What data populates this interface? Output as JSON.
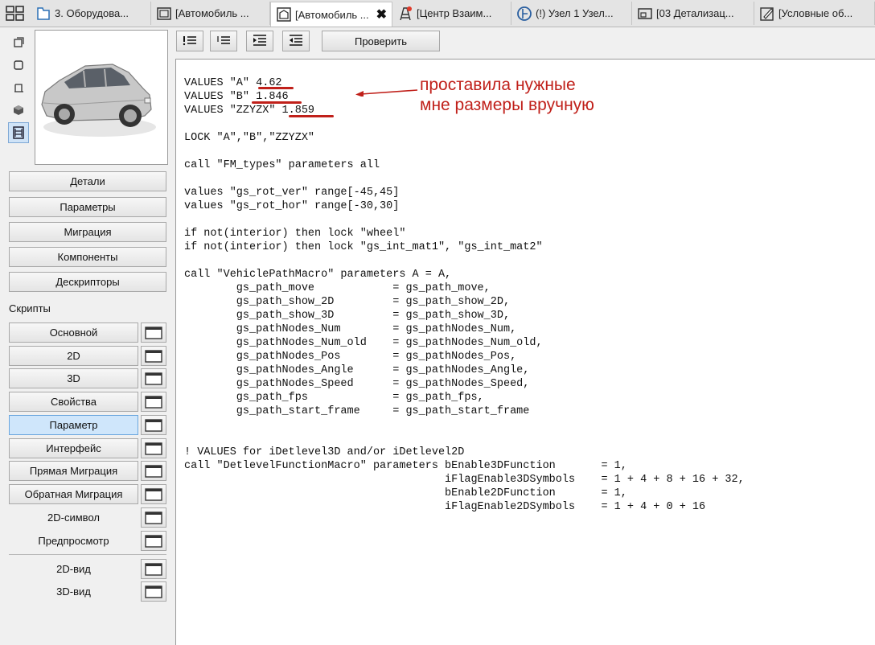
{
  "tabs": [
    {
      "label": "3. Оборудова...",
      "icon": "layout-icon"
    },
    {
      "label": "[Автомобиль ...",
      "icon": "object-icon"
    },
    {
      "label": "[Автомобиль ...",
      "icon": "gdl-object-icon",
      "active": true,
      "close": "✖"
    },
    {
      "label": "[Центр Взаим...",
      "icon": "tower-icon"
    },
    {
      "label": "(!) Узел 1 Узел...",
      "icon": "detail-icon"
    },
    {
      "label": "[03 Детализац...",
      "icon": "window-icon"
    },
    {
      "label": "[Условные об...",
      "icon": "edit-icon"
    }
  ],
  "panel_buttons": [
    "Детали",
    "Параметры",
    "Миграция",
    "Компоненты",
    "Дескрипторы"
  ],
  "scripts_label": "Скрипты",
  "scripts": [
    {
      "label": "Основной"
    },
    {
      "label": "2D"
    },
    {
      "label": "3D"
    },
    {
      "label": "Свойства"
    },
    {
      "label": "Параметр",
      "selected": true
    },
    {
      "label": "Интерфейс"
    },
    {
      "label": "Прямая Миграция"
    },
    {
      "label": "Обратная Миграция"
    },
    {
      "label": "2D-символ",
      "plain": true
    },
    {
      "label": "Предпросмотр",
      "plain": true
    }
  ],
  "views": [
    {
      "label": "2D-вид"
    },
    {
      "label": "3D-вид"
    }
  ],
  "toolbar": {
    "check_label": "Проверить"
  },
  "code": "VALUES \"A\" 4.62\nVALUES \"B\" 1.846\nVALUES \"ZZYZX\" 1.859\n\nLOCK \"A\",\"B\",\"ZZYZX\"\n\ncall \"FM_types\" parameters all\n\nvalues \"gs_rot_ver\" range[-45,45]\nvalues \"gs_rot_hor\" range[-30,30]\n\nif not(interior) then lock \"wheel\"\nif not(interior) then lock \"gs_int_mat1\", \"gs_int_mat2\"\n\ncall \"VehiclePathMacro\" parameters A = A,\n        gs_path_move            = gs_path_move,\n        gs_path_show_2D         = gs_path_show_2D,\n        gs_path_show_3D         = gs_path_show_3D,\n        gs_pathNodes_Num        = gs_pathNodes_Num,\n        gs_pathNodes_Num_old    = gs_pathNodes_Num_old,\n        gs_pathNodes_Pos        = gs_pathNodes_Pos,\n        gs_pathNodes_Angle      = gs_pathNodes_Angle,\n        gs_pathNodes_Speed      = gs_pathNodes_Speed,\n        gs_path_fps             = gs_path_fps,\n        gs_path_start_frame     = gs_path_start_frame\n\n\n! VALUES for iDetlevel3D and/or iDetlevel2D\ncall \"DetlevelFunctionMacro\" parameters bEnable3DFunction       = 1,\n                                        iFlagEnable3DSymbols    = 1 + 4 + 8 + 16 + 32,\n                                        bEnable2DFunction       = 1,\n                                        iFlagEnable2DSymbols    = 1 + 4 + 0 + 16",
  "annotation": {
    "line1": "проставила нужные",
    "line2": "мне размеры вручную",
    "color": "#c0201a"
  }
}
